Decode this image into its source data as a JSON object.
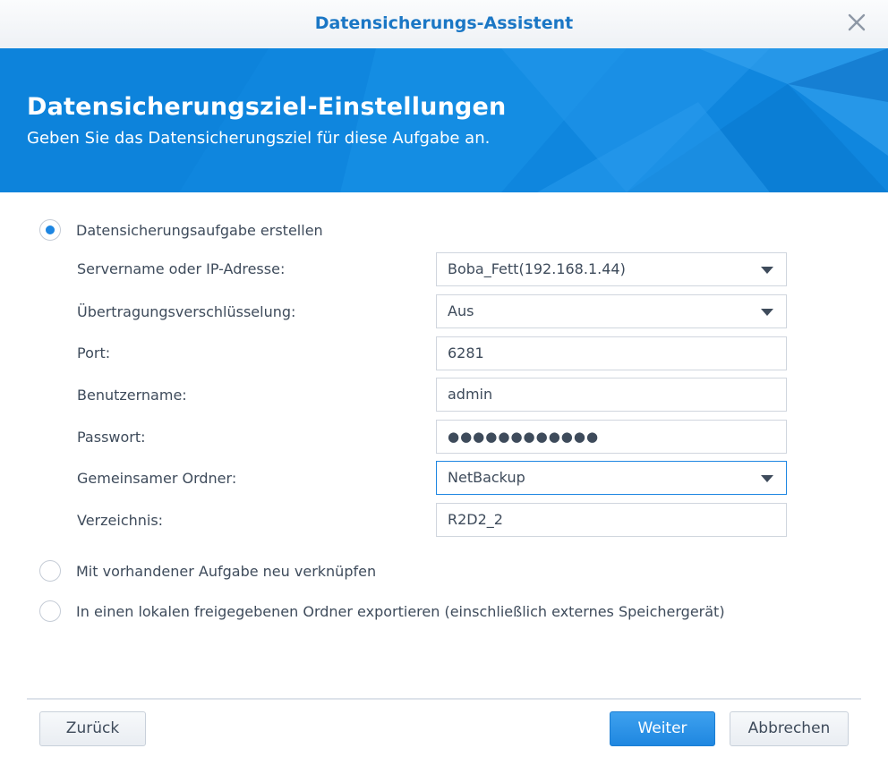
{
  "window": {
    "title": "Datensicherungs-Assistent",
    "close_icon": "close-icon"
  },
  "banner": {
    "heading": "Datensicherungsziel-Einstellungen",
    "subheading": "Geben Sie das Datensicherungsziel für diese Aufgabe an.",
    "color": "#0f86de"
  },
  "options": {
    "create_task": {
      "label": "Datensicherungsaufgabe erstellen",
      "selected": true
    },
    "relink_task": {
      "label": "Mit vorhandener Aufgabe neu verknüpfen",
      "selected": false
    },
    "export_local": {
      "label": "In einen lokalen freigegebenen Ordner exportieren (einschließlich externes Speichergerät)",
      "selected": false
    }
  },
  "form": {
    "server": {
      "label": "Servername oder IP-Adresse:",
      "value": "Boba_Fett(192.168.1.44)"
    },
    "encryption": {
      "label": "Übertragungsverschlüsselung:",
      "value": "Aus"
    },
    "port": {
      "label": "Port:",
      "value": "6281"
    },
    "username": {
      "label": "Benutzername:",
      "value": "admin"
    },
    "password": {
      "label": "Passwort:",
      "value": "●●●●●●●●●●●●"
    },
    "shared_folder": {
      "label": "Gemeinsamer Ordner:",
      "value": "NetBackup"
    },
    "directory": {
      "label": "Verzeichnis:",
      "value": "R2D2_2"
    }
  },
  "footer": {
    "back_label": "Zurück",
    "next_label": "Weiter",
    "cancel_label": "Abbrechen",
    "accent": "#1f87e0"
  }
}
